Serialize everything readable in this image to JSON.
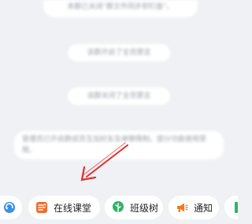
{
  "notices": [
    "本群已关闭“群文件同步到钉盘”。",
    "该群开启了全员禁言",
    "该群关闭了全员禁言",
    "管理员已开启群成员互加好友及单聊限制。部分功能使用受限。"
  ],
  "toolbar": {
    "items": [
      {
        "label": "",
        "icon": "refresh-icon",
        "color": "#3a8ee6"
      },
      {
        "label": "在线课堂",
        "icon": "classroom-icon",
        "color": "#f26b2e"
      },
      {
        "label": "班级树",
        "icon": "tree-icon",
        "color": "#2fb36a"
      },
      {
        "label": "通知",
        "icon": "megaphone-icon",
        "color": "#f07a1a"
      },
      {
        "label": "",
        "icon": "green-bar-icon",
        "color": "#2fb36a"
      }
    ]
  },
  "annotation": {
    "arrow_color": "#e03030"
  }
}
